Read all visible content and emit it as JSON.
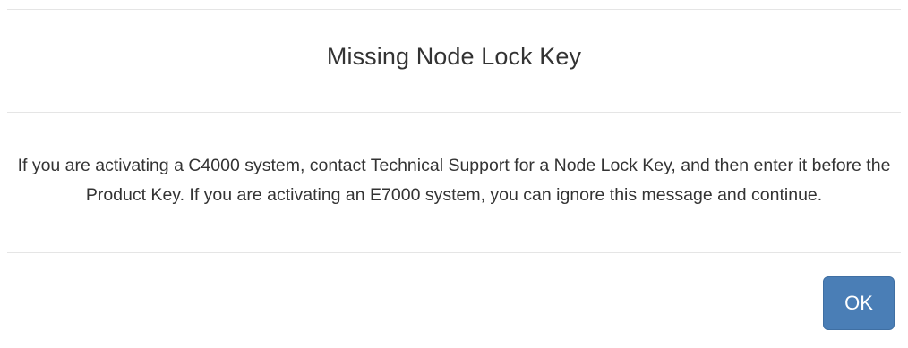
{
  "dialog": {
    "title": "Missing Node Lock Key",
    "message": "If you are activating a C4000 system, contact Technical Support for a Node Lock Key, and then enter it before the Product Key. If you are activating an E7000 system, you can ignore this message and continue.",
    "ok_label": "OK"
  },
  "colors": {
    "primary_button": "#4a7eb6",
    "text": "#333333",
    "divider": "#e5e5e5"
  }
}
